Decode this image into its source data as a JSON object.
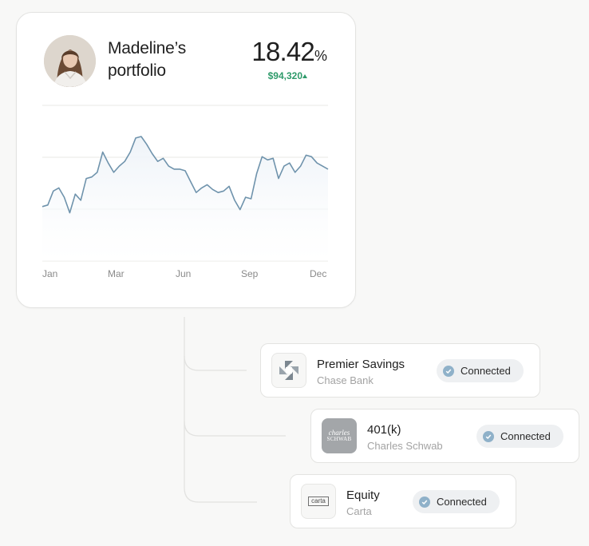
{
  "portfolio": {
    "owner_line1": "Madeline’s",
    "owner_line2": "portfolio",
    "return_value": "18.42",
    "return_unit": "%",
    "gain_value": "$94,320",
    "gain_direction": "up"
  },
  "chart_data": {
    "type": "area",
    "title": "",
    "xlabel": "",
    "ylabel": "",
    "x_ticks": [
      "Jan",
      "Mar",
      "Jun",
      "Sep",
      "Dec"
    ],
    "grid": "horizontal",
    "line_color": "#6f93ac",
    "fill_color": "#eef3f8",
    "values": [
      35,
      36,
      45,
      47,
      41,
      31,
      43,
      39,
      53,
      54,
      57,
      70,
      63,
      57,
      61,
      64,
      70,
      79,
      80,
      75,
      69,
      64,
      66,
      61,
      59,
      59,
      58,
      51,
      44,
      47,
      49,
      46,
      44,
      45,
      48,
      39,
      33,
      41,
      40,
      56,
      67,
      65,
      66,
      53,
      61,
      63,
      57,
      61,
      68,
      67,
      63,
      61,
      59
    ]
  },
  "accounts": [
    {
      "name": "Premier Savings",
      "institution": "Chase Bank",
      "status": "Connected",
      "logo": "chase-octagon-logo"
    },
    {
      "name": "401(k)",
      "institution": "Charles Schwab",
      "status": "Connected",
      "logo": "charles-schwab-logo"
    },
    {
      "name": "Equity",
      "institution": "Carta",
      "status": "Connected",
      "logo": "carta-logo"
    }
  ],
  "logos": {
    "schwab_text_1": "charles",
    "schwab_text_2": "SCHWAB",
    "carta_text": "carta"
  },
  "colors": {
    "gain_green": "#2e9a6a",
    "check_blue": "#8fb1c9",
    "pill_bg": "#eef0f2"
  }
}
